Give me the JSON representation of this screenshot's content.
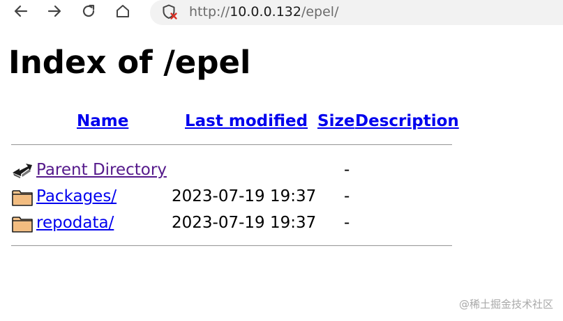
{
  "browser": {
    "url_scheme": "http://",
    "url_host": "10.0.0.132",
    "url_path": "/epel/",
    "security_state": "not-secure",
    "icons": {
      "back": "back-arrow-icon",
      "forward": "forward-arrow-icon",
      "reload": "reload-icon",
      "home": "home-icon",
      "security": "not-secure-shield-icon"
    }
  },
  "page": {
    "title": "Index of /epel",
    "columns": {
      "name": "Name",
      "last_modified": "Last modified",
      "size": "Size",
      "description": "Description"
    },
    "entries": [
      {
        "name": "Parent Directory",
        "modified": "",
        "size": "-",
        "icon": "parent-directory-icon",
        "visited": true
      },
      {
        "name": "Packages/",
        "modified": "2023-07-19 19:37",
        "size": "-",
        "icon": "folder-icon",
        "visited": false
      },
      {
        "name": "repodata/",
        "modified": "2023-07-19 19:37",
        "size": "-",
        "icon": "folder-icon",
        "visited": false
      }
    ]
  },
  "watermark": "@稀土掘金技术社区",
  "colors": {
    "link": "#0000ee",
    "visited_link": "#551a8b",
    "address_bar_bg": "#f2f2f2",
    "warning_red": "#d93025"
  }
}
